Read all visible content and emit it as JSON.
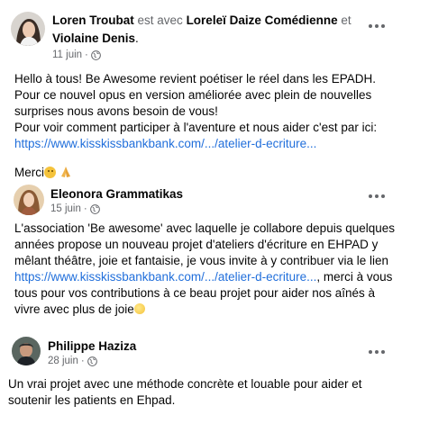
{
  "posts": [
    {
      "author": "Loren Troubat",
      "with_text": "est avec",
      "tag1": "Loreleï Daize Comédienne",
      "and_text": "et",
      "tag2": "Violaine Denis",
      "tag_end": ".",
      "date": "11 juin",
      "privacy_icon": "globe-icon",
      "body_lines": [
        "Hello à tous! Be Awesome revient poétiser le réel dans les EPADH.",
        "Pour ce nouvel opus en version améliorée avec plein de nouvelles",
        "surprises nous avons besoin de vous!",
        "Pour voir comment participer à l'aventure et nous aider c'est par ici:"
      ],
      "link": "https://www.kisskissbankbank.com/.../atelier-d-ecriture...",
      "closing": "Merci",
      "closing_emojis": [
        "smile-emoji",
        "pray-emoji"
      ]
    },
    {
      "author": "Eleonora Grammatikas",
      "date": "15 juin",
      "privacy_icon": "globe-icon",
      "body_lines": [
        "L'association 'Be awesome' avec laquelle je collabore depuis quelques",
        "années propose un nouveau projet d'ateliers d'écriture en EHPAD y",
        "mêlant théâtre, joie et fantaisie, je vous invite à y contribuer via le lien"
      ],
      "link": "https://www.kisskissbankbank.com/.../atelier-d-ecriture...",
      "after_link": ", merci à vous",
      "tail_lines": [
        "tous pour vos contributions à ce beau projet pour aider nos aînés à",
        "vivre avec plus de joie"
      ],
      "tail_emoji": "sun-emoji"
    },
    {
      "author": "Philippe Haziza",
      "date": "28 juin",
      "privacy_icon": "globe-icon",
      "body_lines": [
        "Un vrai projet avec une méthode concrète et louable pour aider et",
        "soutenir les patients en Ehpad."
      ]
    }
  ],
  "date_separator": "·",
  "colors": {
    "link": "#216fdb",
    "muted": "#65676b",
    "text": "#050505"
  }
}
